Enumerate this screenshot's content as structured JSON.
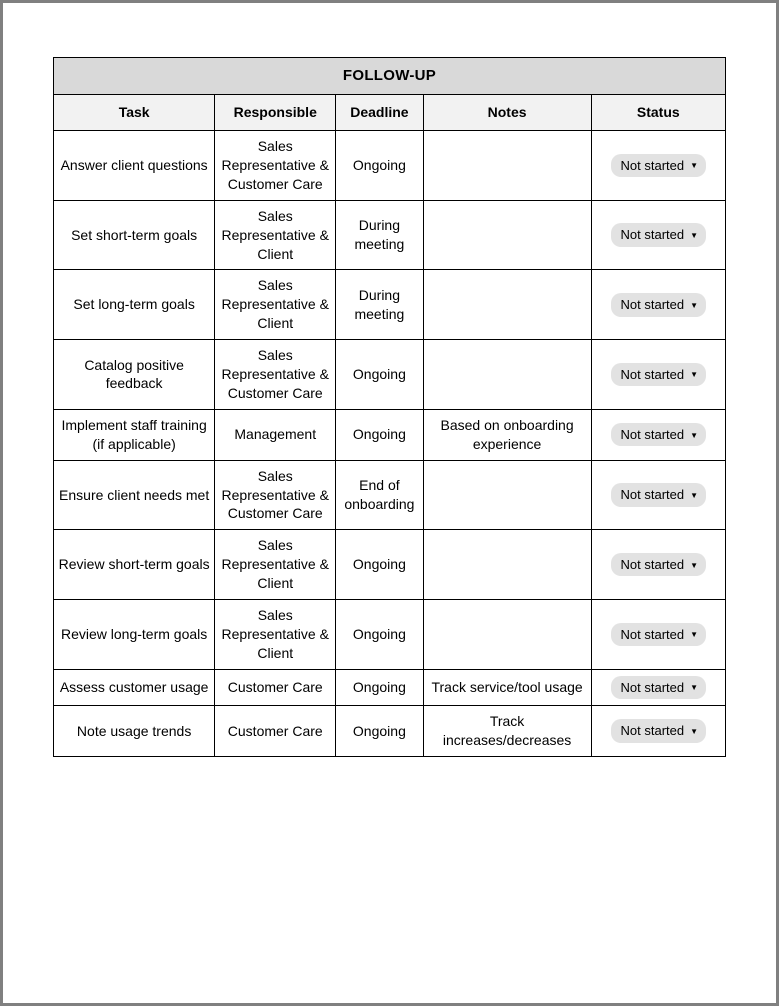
{
  "section_title": "FOLLOW-UP",
  "columns": {
    "task": "Task",
    "responsible": "Responsible",
    "deadline": "Deadline",
    "notes": "Notes",
    "status": "Status"
  },
  "rows": [
    {
      "task": "Answer client questions",
      "responsible": "Sales Representative & Customer Care",
      "deadline": "Ongoing",
      "notes": "",
      "status": "Not started"
    },
    {
      "task": "Set short-term goals",
      "responsible": "Sales Representative & Client",
      "deadline": "During meeting",
      "notes": "",
      "status": "Not started"
    },
    {
      "task": "Set long-term goals",
      "responsible": "Sales Representative & Client",
      "deadline": "During meeting",
      "notes": "",
      "status": "Not started"
    },
    {
      "task": "Catalog positive feedback",
      "responsible": "Sales Representative & Customer Care",
      "deadline": "Ongoing",
      "notes": "",
      "status": "Not started"
    },
    {
      "task": "Implement staff training (if applicable)",
      "responsible": "Management",
      "deadline": "Ongoing",
      "notes": "Based on onboarding experience",
      "status": "Not started"
    },
    {
      "task": "Ensure client needs met",
      "responsible": "Sales Representative & Customer Care",
      "deadline": "End of onboarding",
      "notes": "",
      "status": "Not started"
    },
    {
      "task": "Review short-term goals",
      "responsible": "Sales Representative & Client",
      "deadline": "Ongoing",
      "notes": "",
      "status": "Not started"
    },
    {
      "task": "Review long-term goals",
      "responsible": "Sales Representative & Client",
      "deadline": "Ongoing",
      "notes": "",
      "status": "Not started"
    },
    {
      "task": "Assess customer usage",
      "responsible": "Customer Care",
      "deadline": "Ongoing",
      "notes": "Track service/tool usage",
      "status": "Not started"
    },
    {
      "task": "Note usage trends",
      "responsible": "Customer Care",
      "deadline": "Ongoing",
      "notes": "Track increases/decreases",
      "status": "Not started"
    }
  ]
}
